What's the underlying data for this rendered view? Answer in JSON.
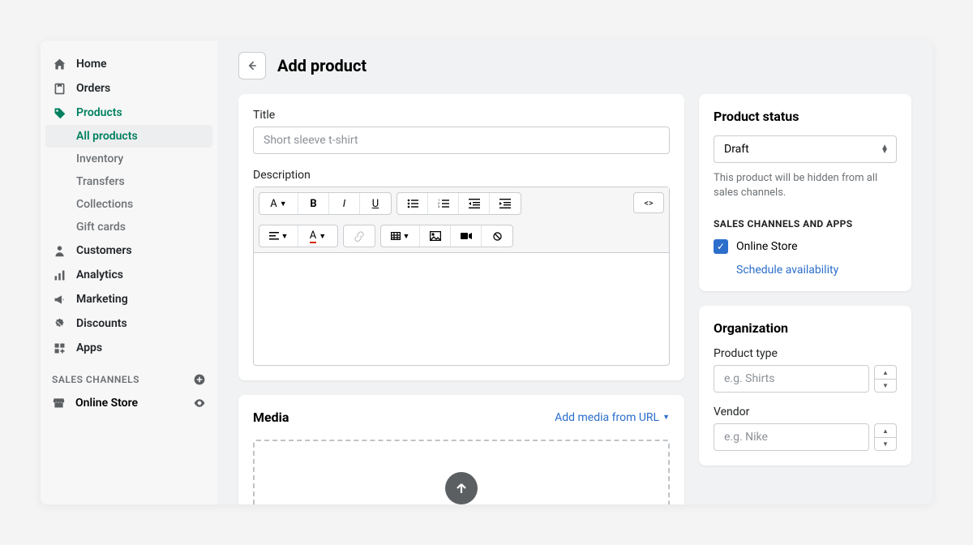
{
  "nav": {
    "home": "Home",
    "orders": "Orders",
    "products": "Products",
    "products_sub": {
      "all": "All products",
      "inventory": "Inventory",
      "transfers": "Transfers",
      "collections": "Collections",
      "gift_cards": "Gift cards"
    },
    "customers": "Customers",
    "analytics": "Analytics",
    "marketing": "Marketing",
    "discounts": "Discounts",
    "apps": "Apps",
    "channels_header": "SALES CHANNELS",
    "online_store": "Online Store"
  },
  "page": {
    "title": "Add product"
  },
  "form": {
    "title_label": "Title",
    "title_placeholder": "Short sleeve t-shirt",
    "desc_label": "Description",
    "media_title": "Media",
    "media_link": "Add media from URL"
  },
  "status": {
    "card_title": "Product status",
    "value": "Draft",
    "hint": "This product will be hidden from all sales channels.",
    "channels_heading": "SALES CHANNELS AND APPS",
    "channel_name": "Online Store",
    "schedule": "Schedule availability"
  },
  "org": {
    "card_title": "Organization",
    "type_label": "Product type",
    "type_placeholder": "e.g. Shirts",
    "vendor_label": "Vendor",
    "vendor_placeholder": "e.g. Nike"
  }
}
